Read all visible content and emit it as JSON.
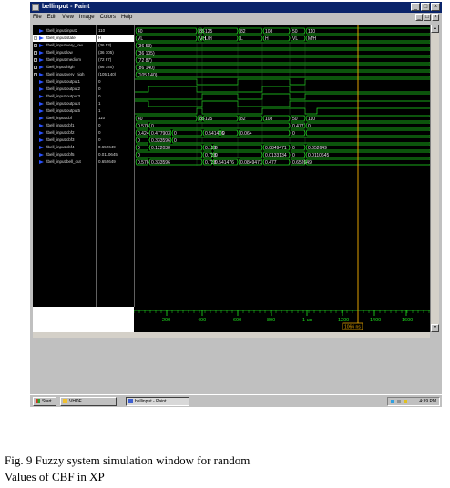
{
  "window": {
    "title": "bellinput - Paint",
    "menu": [
      "File",
      "Edit",
      "View",
      "Image",
      "Colors",
      "Help"
    ],
    "buttons": [
      "_",
      "□",
      "×"
    ],
    "mdi_buttons": [
      "_",
      "□",
      "×"
    ]
  },
  "signals": [
    {
      "name": "/tbell_input/input2",
      "value": "110",
      "expand": false,
      "selected": false
    },
    {
      "name": "/tbell_input/state",
      "value": "H",
      "expand": true,
      "selected": true
    },
    {
      "name": "/tbell_input/very_low",
      "value": "(36 53)",
      "expand": true,
      "selected": false
    },
    {
      "name": "/tbell_input/low",
      "value": "(36 105)",
      "expand": true,
      "selected": false
    },
    {
      "name": "/tbell_input/medium",
      "value": "(72 87)",
      "expand": true,
      "selected": false
    },
    {
      "name": "/tbell_input/high",
      "value": "(86 140)",
      "expand": true,
      "selected": false
    },
    {
      "name": "/tbell_input/very_high",
      "value": "(105 140)",
      "expand": true,
      "selected": false
    },
    {
      "name": "/tbell_input/output1",
      "value": "0",
      "expand": false,
      "selected": false
    },
    {
      "name": "/tbell_input/output2",
      "value": "0",
      "expand": false,
      "selected": false
    },
    {
      "name": "/tbell_input/output3",
      "value": "0",
      "expand": false,
      "selected": false
    },
    {
      "name": "/tbell_input/output4",
      "value": "1",
      "expand": false,
      "selected": false
    },
    {
      "name": "/tbell_input/output5",
      "value": "1",
      "expand": false,
      "selected": false
    },
    {
      "name": "/tbell_input/cbf",
      "value": "110",
      "expand": false,
      "selected": false
    },
    {
      "name": "/tbell_input/cbf1",
      "value": "0",
      "expand": false,
      "selected": false
    },
    {
      "name": "/tbell_input/cbf2",
      "value": "0",
      "expand": false,
      "selected": false
    },
    {
      "name": "/tbell_input/cbf3",
      "value": "0",
      "expand": false,
      "selected": false
    },
    {
      "name": "/tbell_input/cbf4",
      "value": "0.652649",
      "expand": false,
      "selected": false
    },
    {
      "name": "/tbell_input/cbf5",
      "value": "0.0110645",
      "expand": false,
      "selected": false
    },
    {
      "name": "/tbell_input/bell_out",
      "value": "0.652649",
      "expand": false,
      "selected": false
    }
  ],
  "wave_labels": {
    "input2": [
      "40",
      "85",
      "125",
      "82",
      "108",
      "50",
      "110"
    ],
    "state": [
      "VL",
      "VH",
      "L/H",
      "L",
      "H",
      "VL",
      "M/H"
    ],
    "very_low": [
      "(36 53)"
    ],
    "low": [
      "(36 105)"
    ],
    "medium": [
      "(72 87)"
    ],
    "high": [
      "(86 140)"
    ],
    "very_high": [
      "(105 140)"
    ],
    "cbf": [
      "40",
      "85",
      "125",
      "82",
      "108",
      "50",
      "110"
    ],
    "cbf1": [
      "0.576",
      "0",
      "0.477",
      "0"
    ],
    "cbf2": [
      "0.424",
      "0.477903",
      "0",
      "0.541476",
      "0",
      "0.064",
      "0"
    ],
    "cbf3": [
      "0",
      "0.333596",
      "0"
    ],
    "cbf4": [
      "0",
      "0.122038",
      "0.199",
      "0",
      "0.0849471",
      "0",
      "0.652649"
    ],
    "cbf5": [
      "0",
      "0.738",
      "0",
      "0.0133134",
      "0",
      "0.0110645"
    ],
    "bell_out": [
      "0.576",
      "0.333596",
      "0.738",
      "0.541476",
      "0.0849471",
      "0.477",
      "0.652649"
    ]
  },
  "timeline": {
    "ticks": [
      "200",
      "400",
      "600",
      "800",
      "1 us",
      "1200",
      "1400",
      "1600"
    ],
    "cursor_label": "1066 ns"
  },
  "taskbar": {
    "start": "Start",
    "items": [
      "VHDE",
      "bellinput - Paint"
    ],
    "clock": "4:39 PM"
  },
  "caption": {
    "line1": "Fig. 9 Fuzzy system simulation window for random",
    "line2": "Values of CBF in XP"
  },
  "colors": {
    "signal_trace": "#20e020",
    "cursor": "#e0a000",
    "titlebar": "#0a246a",
    "signal_icon": "#2850ff"
  }
}
